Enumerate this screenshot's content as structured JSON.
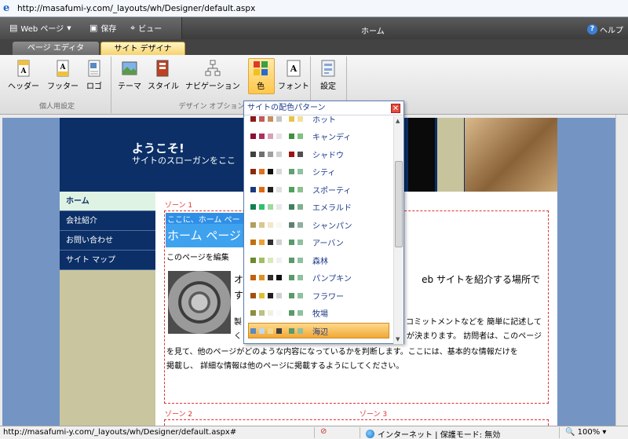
{
  "browser": {
    "address": "http://masafumi-y.com/_layouts/wh/Designer/default.aspx"
  },
  "toolbar": {
    "web_page": "Web ページ",
    "save": "保存",
    "view": "ビュー",
    "title": "ホーム",
    "help": "ヘルプ"
  },
  "tabs": {
    "page_editor": "ページ エディタ",
    "site_designer": "サイト デザイナ"
  },
  "ribbon": {
    "group_personal": "個人用設定",
    "group_design": "デザイン オプション",
    "buttons": {
      "header": "ヘッダー",
      "footer": "フッター",
      "logo": "ロゴ",
      "theme": "テーマ",
      "style": "スタイル",
      "navigation": "ナビゲーション",
      "color": "色",
      "font": "フォント",
      "settings": "設定"
    }
  },
  "site": {
    "welcome": "ようこそ!",
    "slogan": "サイトのスローガンをここ",
    "nav": [
      "ホーム",
      "会社紹介",
      "お問い合わせ",
      "サイト マップ"
    ],
    "zone1": "ゾーン 1",
    "zone2": "ゾーン 2",
    "zone3": "ゾーン 3",
    "banner_here": "ここに、ホーム ペー",
    "banner_title": "ホーム ページ",
    "edit_link": "このページを編集",
    "text_o": "オ",
    "text_su": "す",
    "text_web": "eb サイトを紹介する場所で",
    "text_mt": "製",
    "text_ku": "く",
    "text_r1": "コミットメントなどを 簡単に記述して",
    "text_r2": "が決まります。 訪問者は、このページ",
    "body_lines": [
      "を見て、他のページがどのような内容になっているかを判断します。ここには、基本的な情報だけを",
      "掲載し、 詳細な情報は他のページに掲載するようにしてください。"
    ]
  },
  "popup": {
    "title": "サイトの配色パターン",
    "close": "✕",
    "palettes": [
      {
        "name": "ホット",
        "colors": [
          "#8a1a1a",
          "#c05b5b",
          "#c09060",
          "#c4c4c4",
          "#e8c24a",
          "#f0e0a0"
        ]
      },
      {
        "name": "キャンディ",
        "colors": [
          "#8a1034",
          "#b03060",
          "#d8a0b8",
          "#e8e0e8",
          "#409040",
          "#80c080"
        ]
      },
      {
        "name": "シャドウ",
        "colors": [
          "#404040",
          "#707070",
          "#a0a0a0",
          "#d0d0d0",
          "#a01010",
          "#505050"
        ]
      },
      {
        "name": "シティ",
        "colors": [
          "#8a2a08",
          "#e07020",
          "#101010",
          "#d8d8d8",
          "#60a070",
          "#90c0a0"
        ]
      },
      {
        "name": "スポーティ",
        "colors": [
          "#1a3a80",
          "#e06810",
          "#202020",
          "#e0e0e0",
          "#50a060",
          "#90c090"
        ]
      },
      {
        "name": "エメラルド",
        "colors": [
          "#108050",
          "#30c070",
          "#a0d8a0",
          "#e8e8e8",
          "#408060",
          "#80b090"
        ]
      },
      {
        "name": "シャンパン",
        "colors": [
          "#b0a060",
          "#d8c890",
          "#f0e8c8",
          "#f8f8f0",
          "#608070",
          "#90b0a0"
        ]
      },
      {
        "name": "アーバン",
        "colors": [
          "#c07010",
          "#f0a030",
          "#303030",
          "#d0d0d0",
          "#5a9a6a",
          "#90c0a0"
        ]
      },
      {
        "name": "森林",
        "colors": [
          "#6a8a30",
          "#a0c060",
          "#d8e8c0",
          "#f0f0f0",
          "#5a9a6a",
          "#90c0a0"
        ]
      },
      {
        "name": "パンプキン",
        "colors": [
          "#c06010",
          "#e09020",
          "#303030",
          "#101010",
          "#5a9a6a",
          "#90c0a0"
        ]
      },
      {
        "name": "フラワー",
        "colors": [
          "#a05010",
          "#e0c030",
          "#202020",
          "#d0d0d0",
          "#5a9a6a",
          "#90c0a0"
        ]
      },
      {
        "name": "牧場",
        "colors": [
          "#8a9040",
          "#c0c080",
          "#f0f0e0",
          "#fafafa",
          "#5a9a6a",
          "#90c0a0"
        ]
      },
      {
        "name": "海辺",
        "colors": [
          "#5a8ac0",
          "#c0d8f0",
          "#f0d890",
          "#404040",
          "#5a9a6a",
          "#90c0a0"
        ]
      }
    ]
  },
  "status": {
    "url": "http://masafumi-y.com/_layouts/wh/Designer/default.aspx#",
    "zone": "インターネット | 保護モード: 無効",
    "zoom": "100%"
  }
}
